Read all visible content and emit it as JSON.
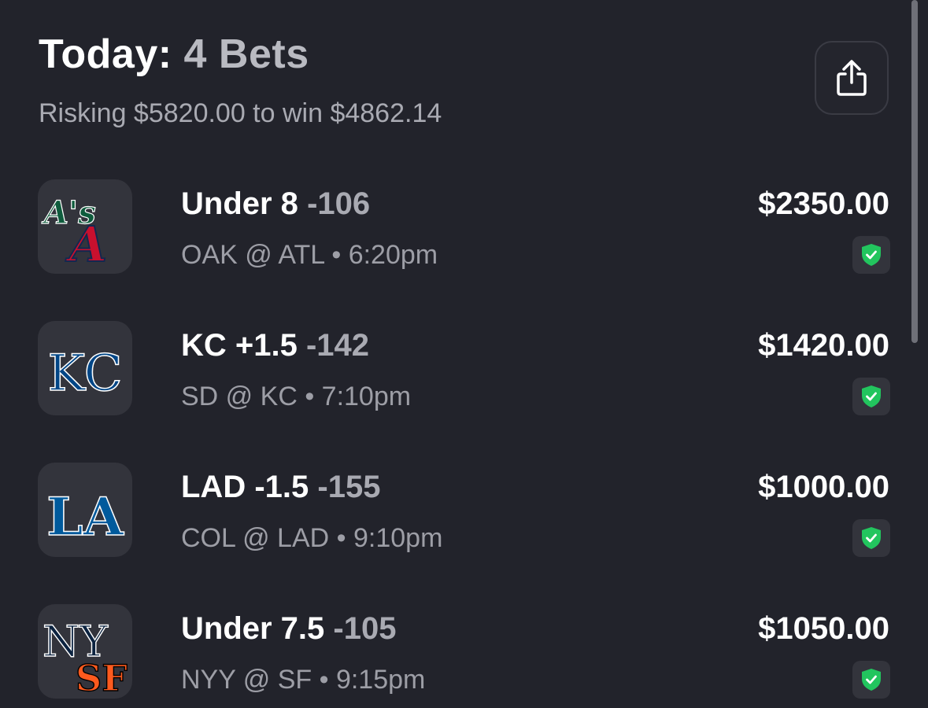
{
  "header": {
    "title_prefix": "Today:",
    "title_count": "4 Bets",
    "subtitle": "Risking $5820.00 to win $4862.14",
    "share_icon": "share-icon"
  },
  "bets": [
    {
      "selection": "Under 8",
      "odds": "-106",
      "matchup": "OAK @ ATL • 6:20pm",
      "amount": "$2350.00",
      "logo_icon": "oak-atl-logo",
      "status_icon": "verified-shield-icon"
    },
    {
      "selection": "KC +1.5",
      "odds": "-142",
      "matchup": "SD @ KC • 7:10pm",
      "amount": "$1420.00",
      "logo_icon": "kc-logo",
      "status_icon": "verified-shield-icon"
    },
    {
      "selection": "LAD -1.5",
      "odds": "-155",
      "matchup": "COL @ LAD • 9:10pm",
      "amount": "$1000.00",
      "logo_icon": "lad-logo",
      "status_icon": "verified-shield-icon"
    },
    {
      "selection": "Under 7.5",
      "odds": "-105",
      "matchup": "NYY @ SF • 9:15pm",
      "amount": "$1050.00",
      "logo_icon": "nyy-sf-logo",
      "status_icon": "verified-shield-icon"
    }
  ],
  "colors": {
    "background": "#22232b",
    "tile": "#33343c",
    "muted_text": "#a9aab2",
    "check_green": "#22c55e"
  },
  "logos": {
    "oak_text": "A's",
    "atl_text": "A",
    "kc_text": "KC",
    "lad_text": "LA",
    "nyy_text": "NY",
    "sf_text": "SF"
  }
}
